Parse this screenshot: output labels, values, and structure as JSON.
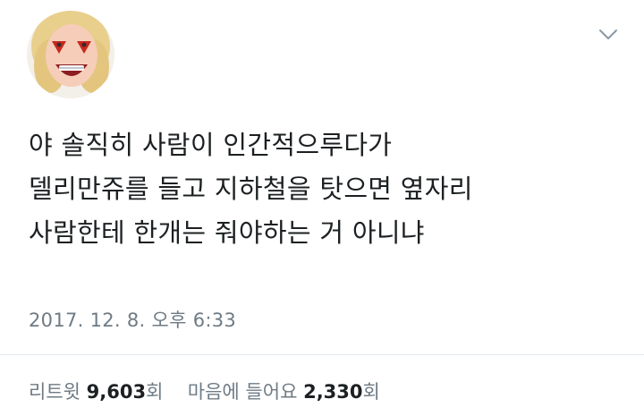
{
  "tweet": {
    "lines": [
      "야 솔직히 사람이 인간적으루다가",
      "델리만쥬를 들고 지하철을 탓으면 옆자리",
      "사람한테 한개는 줘야하는 거 아니냐"
    ],
    "timestamp": "2017. 12. 8. 오후 6:33"
  },
  "stats": {
    "retweets_label": "리트윗",
    "retweets_count": "9,603",
    "retweets_unit": "회",
    "likes_label": "마음에 들어요",
    "likes_count": "2,330",
    "likes_unit": "회"
  },
  "icons": {
    "menu": "chevron-down-icon",
    "avatar": "avatar"
  },
  "colors": {
    "text": "#1c2022",
    "muted": "#6e7b85",
    "divider": "#e1e8ed"
  }
}
